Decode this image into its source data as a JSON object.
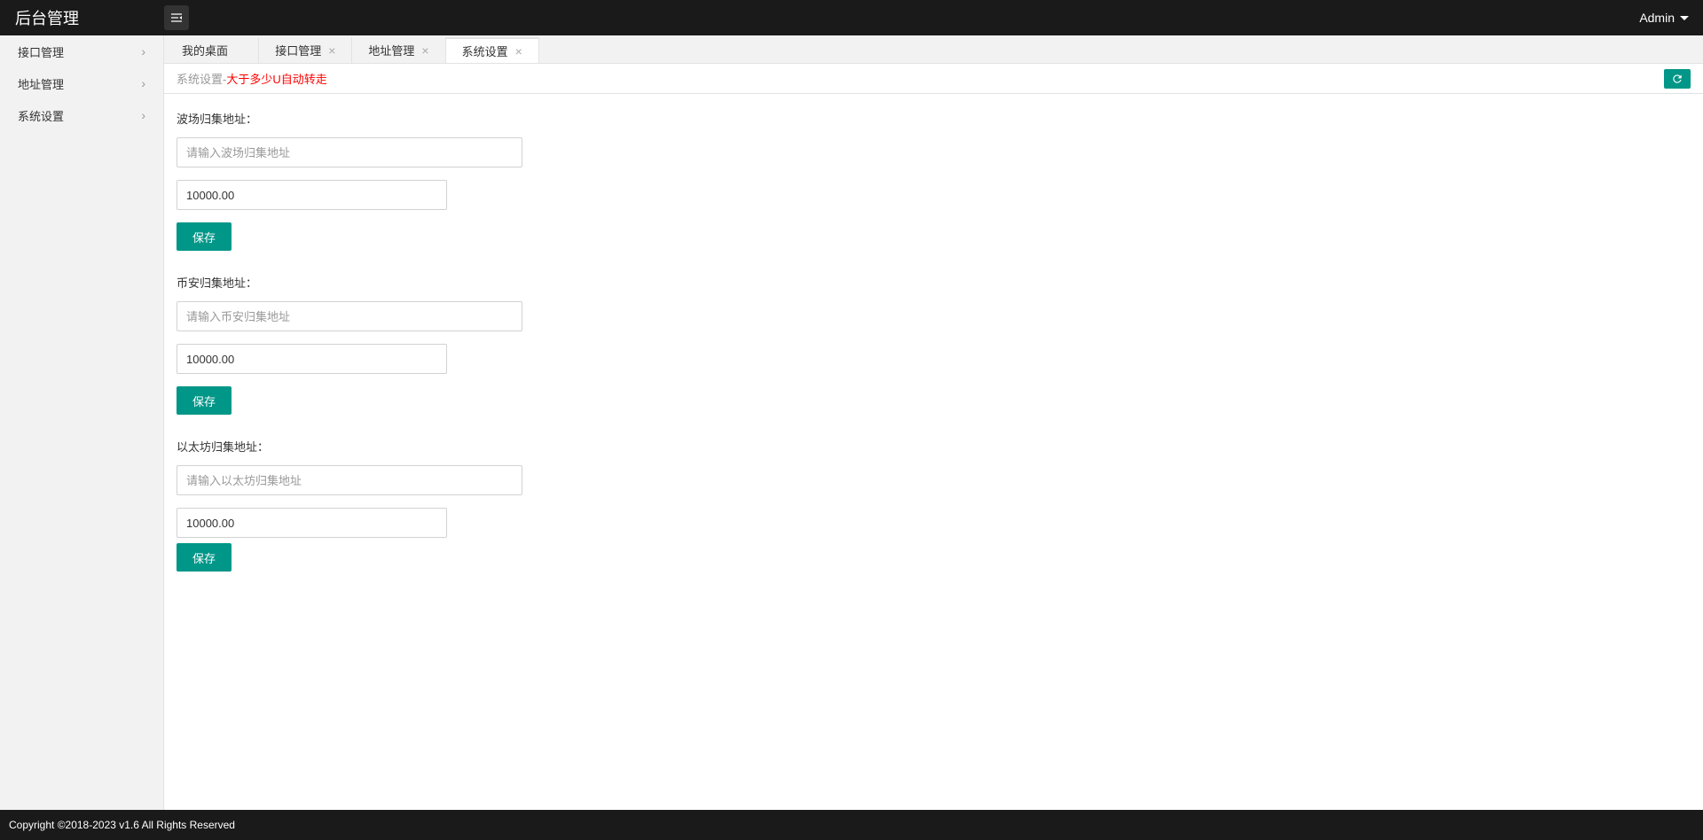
{
  "header": {
    "logo": "后台管理",
    "user_label": "Admin"
  },
  "sidebar": {
    "items": [
      {
        "label": "接口管理"
      },
      {
        "label": "地址管理"
      },
      {
        "label": "系统设置"
      }
    ]
  },
  "tabs": [
    {
      "label": "我的桌面",
      "closable": false,
      "active": false
    },
    {
      "label": "接口管理",
      "closable": true,
      "active": false
    },
    {
      "label": "地址管理",
      "closable": true,
      "active": false
    },
    {
      "label": "系统设置",
      "closable": true,
      "active": true
    }
  ],
  "toolbar": {
    "title_prefix": "系统设置-",
    "title_accent": "大于多少U自动转走"
  },
  "forms": [
    {
      "label": "波场归集地址：",
      "placeholder": "请输入波场归集地址",
      "value1": "",
      "value2": "10000.00",
      "save_label": "保存"
    },
    {
      "label": "币安归集地址：",
      "placeholder": "请输入币安归集地址",
      "value1": "",
      "value2": "10000.00",
      "save_label": "保存"
    },
    {
      "label": "以太坊归集地址：",
      "placeholder": "请输入以太坊归集地址",
      "value1": "",
      "value2": "10000.00",
      "save_label": "保存"
    }
  ],
  "footer": {
    "text": "Copyright ©2018-2023 v1.6 All Rights Reserved"
  }
}
